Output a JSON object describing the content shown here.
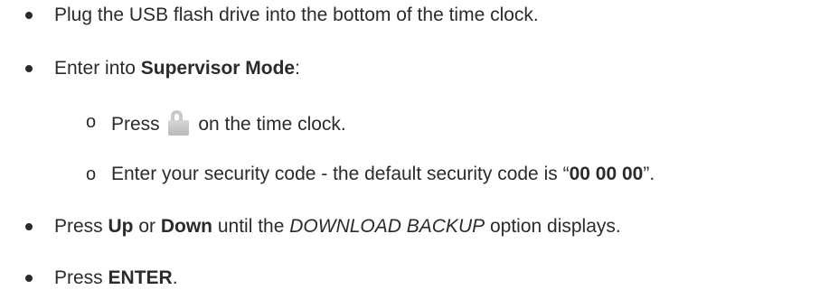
{
  "steps": [
    {
      "text": "Plug the USB flash drive into the bottom of the time clock."
    },
    {
      "before": "Enter into ",
      "bold": "Supervisor Mode",
      "after": ":",
      "substeps": [
        {
          "marker": "o",
          "before": "Press ",
          "icon": "unlock-padlock-icon",
          "after": " on the time clock."
        },
        {
          "marker": "o",
          "before": "Enter your security code - the default security code is “",
          "bold": "00 00 00",
          "after": "”."
        }
      ]
    },
    {
      "before": "Press ",
      "bold1": "Up",
      "mid1": " or ",
      "bold2": "Down",
      "mid2": " until the ",
      "italic": "DOWNLOAD BACKUP",
      "after": " option displays."
    },
    {
      "before": "Press ",
      "bold": "ENTER",
      "after": "."
    }
  ],
  "colors": {
    "text": "#2b2b2b",
    "icon": "#c4c4c4"
  }
}
